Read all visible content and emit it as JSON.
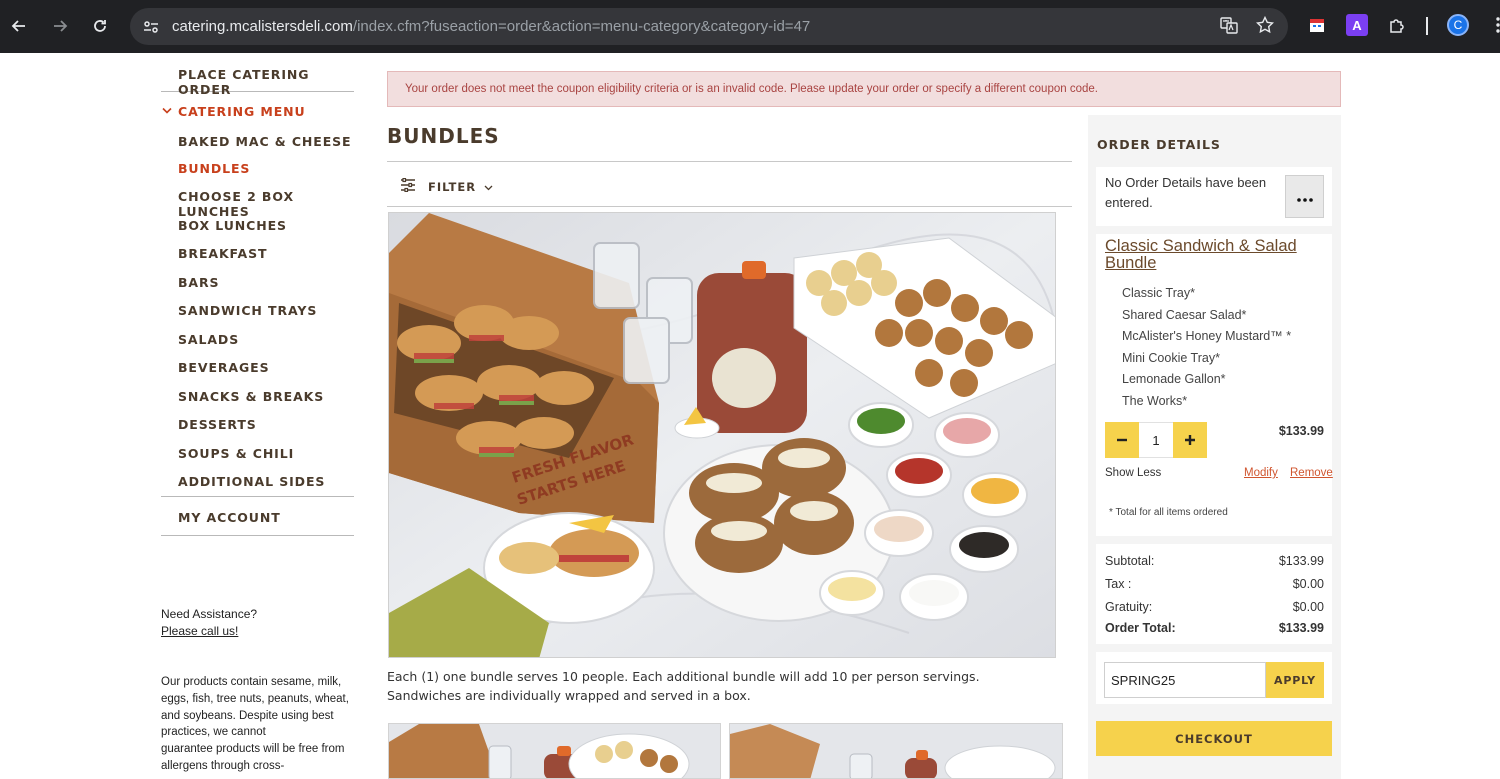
{
  "browser": {
    "url_host": "catering.mcalistersdeli.com",
    "url_path": "/index.cfm?fuseaction=order&action=menu-category&category-id=47",
    "profile_initial": "C",
    "extension_letter": "A",
    "colors": {
      "bar": "#202124",
      "omnibox": "#35363a",
      "profile": "#1a73e8",
      "extension": "#7b3ff2"
    }
  },
  "sidebar": {
    "place_order": "PLACE CATERING ORDER",
    "catering_menu": "CATERING MENU",
    "items": [
      "BAKED MAC & CHEESE",
      "BUNDLES",
      "CHOOSE 2 BOX LUNCHES",
      "BOX LUNCHES",
      "BREAKFAST",
      "BARS",
      "SANDWICH TRAYS",
      "SALADS",
      "BEVERAGES",
      "SNACKS & BREAKS",
      "DESSERTS",
      "SOUPS & CHILI",
      "ADDITIONAL SIDES"
    ],
    "active_item": "BUNDLES",
    "my_account": "MY ACCOUNT",
    "assistance": "Need Assistance?",
    "call_link": "Please call us!",
    "allergen_lines": [
      "Our products contain sesame, milk,",
      "eggs, fish, tree nuts, peanuts, wheat,",
      "and soybeans. Despite using best",
      "practices, we cannot",
      "guarantee products will be free from",
      "allergens through cross-"
    ]
  },
  "alert": {
    "text": "Your order does not meet the coupon eligibility criteria or is an invalid code. Please update your order or specify a different coupon code.",
    "colors": {
      "bg": "#f2dede",
      "text": "#a94442"
    }
  },
  "main": {
    "title": "BUNDLES",
    "filter_label": "FILTER",
    "hero_box_text": [
      "FRESH FLAVOR",
      "STARTS HERE"
    ],
    "description": "Each (1) one bundle serves 10 people. Each additional bundle will add 10 per person servings. Sandwiches are individually wrapped and served in a box."
  },
  "order": {
    "title": "ORDER DETAILS",
    "no_details": "No Order Details have been entered.",
    "item_name": "Classic Sandwich & Salad Bundle",
    "components": [
      "Classic Tray*",
      "Shared Caesar Salad*",
      "McAlister's Honey Mustard™ *",
      "Mini Cookie Tray*",
      "Lemonade Gallon*",
      "The Works*"
    ],
    "quantity": "1",
    "price": "$133.99",
    "show_less": "Show Less",
    "modify": "Modify",
    "remove": "Remove",
    "note": "* Total for all items ordered",
    "totals": [
      {
        "label": "Subtotal:",
        "value": "$133.99"
      },
      {
        "label": "Tax :",
        "value": "$0.00"
      },
      {
        "label": "Gratuity:",
        "value": "$0.00"
      },
      {
        "label": "Order Total:",
        "value": "$133.99"
      }
    ],
    "coupon_value": "SPRING25",
    "apply_label": "APPLY",
    "checkout_label": "CHECKOUT",
    "colors": {
      "accent": "#f6d24c",
      "brown": "#4a3b2c",
      "red": "#c8401c",
      "link": "#d0552f"
    }
  }
}
